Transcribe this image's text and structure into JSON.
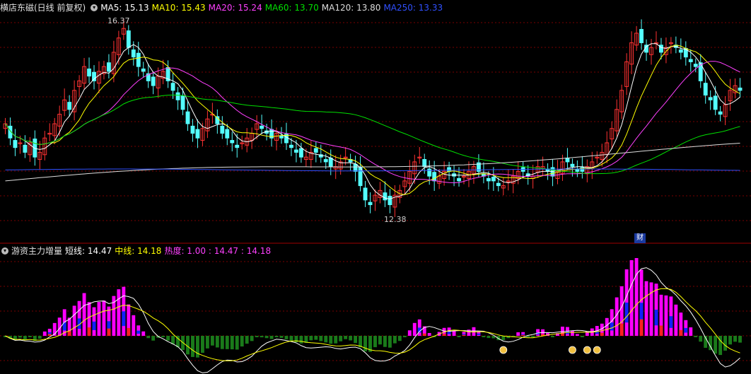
{
  "top_legend": {
    "title": "横店东磁(日线 前复权)",
    "ma5": "MA5: 15.13",
    "ma10": "MA10: 15.43",
    "ma20": "MA20: 15.24",
    "ma60": "MA60: 13.70",
    "ma120": "MA120: 13.80",
    "ma250": "MA250: 13.33"
  },
  "annotations": {
    "high": "16.37",
    "low": "12.38",
    "badge": "财"
  },
  "bottom_legend": {
    "title": "游资主力增量",
    "short": "短线: 14.47",
    "mid": "中线: 14.18",
    "heat": "热度: 1.00 : 14.47 : 14.18"
  },
  "colors": {
    "up": "#ff3232",
    "down": "#54ffff",
    "ma5": "#ffffff",
    "ma10": "#ffff00",
    "ma20": "#ff40ff",
    "ma60": "#00e000",
    "ma120": "#dddddd",
    "ma250": "#3050ff"
  },
  "chart_data": {
    "type": "candlestick",
    "ylim": [
      12.0,
      16.6
    ],
    "x": [
      1,
      2,
      3,
      4,
      5,
      6,
      7,
      8,
      9,
      10,
      11,
      12,
      13,
      14,
      15,
      16,
      17,
      18,
      19,
      20,
      21,
      22,
      23,
      24,
      25,
      26,
      27,
      28,
      29,
      30,
      31,
      32,
      33,
      34,
      35,
      36,
      37,
      38,
      39,
      40,
      41,
      42,
      43,
      44,
      45,
      46,
      47,
      48,
      49,
      50,
      51,
      52,
      53,
      54,
      55,
      56,
      57,
      58,
      59,
      60,
      61,
      62,
      63,
      64,
      65,
      66,
      67,
      68,
      69,
      70,
      71,
      72,
      73,
      74,
      75,
      76,
      77,
      78,
      79,
      80,
      81,
      82,
      83,
      84,
      85,
      86,
      87,
      88,
      89,
      90,
      91,
      92,
      93,
      94,
      95,
      96,
      97,
      98,
      99,
      100,
      101,
      102,
      103,
      104,
      105,
      106,
      107,
      108,
      109,
      110,
      111,
      112,
      113,
      114,
      115,
      116,
      117,
      118,
      119,
      120,
      121,
      122,
      123,
      124,
      125,
      126,
      127,
      128,
      129,
      130,
      131,
      132,
      133,
      134,
      135,
      136,
      137,
      138,
      139,
      140,
      141,
      142,
      143,
      144,
      145,
      146,
      147,
      148,
      149,
      150
    ],
    "close": [
      14.3,
      14.0,
      13.8,
      13.9,
      13.7,
      13.9,
      13.6,
      13.7,
      14.0,
      14.1,
      14.3,
      14.5,
      14.8,
      14.6,
      15.0,
      15.2,
      15.5,
      15.3,
      15.2,
      15.4,
      15.5,
      15.4,
      15.8,
      16.1,
      16.3,
      15.9,
      15.7,
      15.5,
      15.4,
      15.2,
      15.1,
      15.3,
      15.4,
      15.2,
      15.0,
      14.8,
      14.6,
      14.3,
      14.1,
      14.0,
      14.2,
      14.4,
      14.5,
      14.3,
      14.1,
      14.0,
      13.9,
      13.8,
      13.9,
      14.0,
      14.1,
      14.3,
      14.2,
      14.1,
      14.0,
      14.1,
      14.0,
      13.9,
      13.8,
      13.7,
      13.6,
      13.6,
      13.7,
      13.7,
      13.6,
      13.5,
      13.4,
      13.4,
      13.5,
      13.6,
      13.5,
      13.3,
      13.0,
      12.7,
      12.6,
      12.8,
      12.9,
      12.7,
      12.6,
      12.8,
      12.9,
      13.1,
      13.3,
      13.5,
      13.6,
      13.4,
      13.2,
      13.1,
      13.2,
      13.3,
      13.3,
      13.2,
      13.1,
      13.2,
      13.3,
      13.4,
      13.3,
      13.2,
      13.1,
      13.1,
      13.0,
      13.0,
      13.1,
      13.2,
      13.3,
      13.3,
      13.2,
      13.2,
      13.4,
      13.4,
      13.3,
      13.2,
      13.3,
      13.5,
      13.5,
      13.4,
      13.3,
      13.3,
      13.4,
      13.5,
      13.6,
      13.7,
      13.9,
      14.2,
      14.6,
      15.0,
      15.6,
      16.0,
      16.2,
      16.0,
      15.8,
      15.9,
      16.0,
      15.8,
      15.9,
      16.0,
      15.9,
      15.8,
      15.7,
      15.6,
      15.5,
      15.2,
      14.9,
      14.8,
      14.6,
      14.5,
      14.7,
      15.0,
      15.1,
      15.0
    ],
    "ma5_last": 15.13,
    "ma10_last": 15.43,
    "ma20_last": 15.24,
    "ma60_last": 13.7,
    "ma120_last": 13.8,
    "ma250_last": 13.33,
    "indicator": {
      "short_last": 14.47,
      "mid_last": 14.18,
      "heat_last": 1.0
    }
  }
}
